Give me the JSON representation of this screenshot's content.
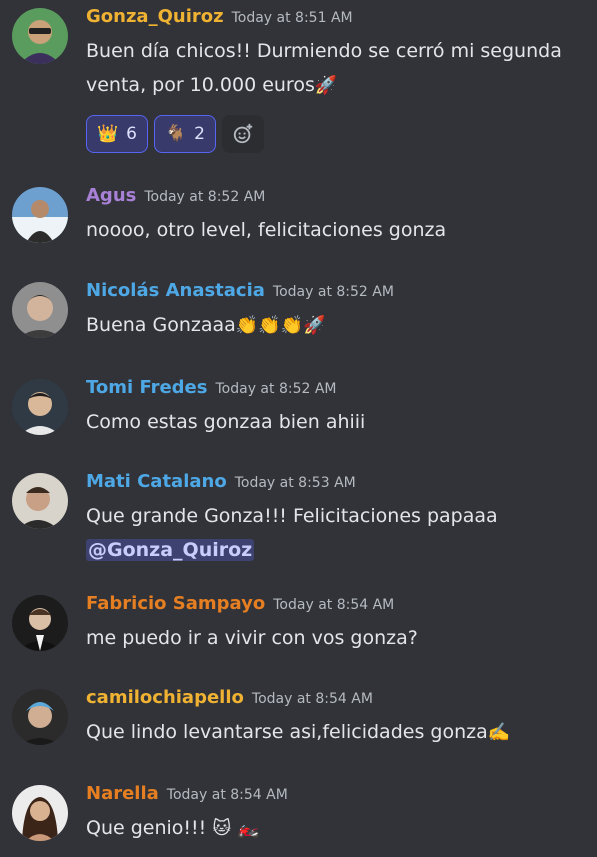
{
  "messages": [
    {
      "username": "Gonza_Quiroz",
      "username_color": "#f0b232",
      "timestamp": "Today at 8:51 AM",
      "lines": [
        "Buen día chicos!! Durmiendo se cerró mi segunda",
        "venta, por 10.000 euros"
      ],
      "trailing_emoji": [
        "rocket-emoji"
      ],
      "reactions": [
        {
          "icon": "crown-emoji",
          "count": "6"
        },
        {
          "icon": "goat-emoji",
          "count": "2"
        }
      ],
      "add_reaction_icon": "add-reaction-icon"
    },
    {
      "username": "Agus",
      "username_color": "#a881d6",
      "timestamp": "Today at 8:52 AM",
      "lines": [
        "noooo, otro level, felicitaciones gonza"
      ]
    },
    {
      "username": "Nicolás Anastacia",
      "username_color": "#4ea8e6",
      "timestamp": "Today at 8:52 AM",
      "lines": [
        "Buena Gonzaaa"
      ],
      "trailing_emoji": [
        "clapping-hands-emoji",
        "clapping-hands-emoji",
        "clapping-hands-emoji",
        "rocket-emoji"
      ]
    },
    {
      "username": "Tomi Fredes",
      "username_color": "#4ea8e6",
      "timestamp": "Today at 8:52 AM",
      "lines": [
        "Como estas gonzaa bien ahiii"
      ]
    },
    {
      "username": "Mati Catalano",
      "username_color": "#4ea8e6",
      "timestamp": "Today at 8:53 AM",
      "lines": [
        "Que grande Gonza!!! Felicitaciones papaaa"
      ],
      "mention": "@Gonza_Quiroz"
    },
    {
      "username": "Fabricio Sampayo",
      "username_color": "#e67e22",
      "timestamp": "Today at 8:54 AM",
      "lines": [
        "me puedo ir a vivir con vos gonza?"
      ]
    },
    {
      "username": "camilochiapello",
      "username_color": "#f0b232",
      "timestamp": "Today at 8:54 AM",
      "lines": [
        "Que lindo levantarse asi,felicidades gonza"
      ],
      "trailing_emoji": [
        "writing-hand-emoji"
      ]
    },
    {
      "username": "Narella",
      "username_color": "#e67e22",
      "timestamp": "Today at 8:54 AM",
      "lines": [
        "Que genio!!!"
      ],
      "trailing_emoji": [
        "cat-emoji",
        "motorcycle-emoji"
      ]
    }
  ]
}
